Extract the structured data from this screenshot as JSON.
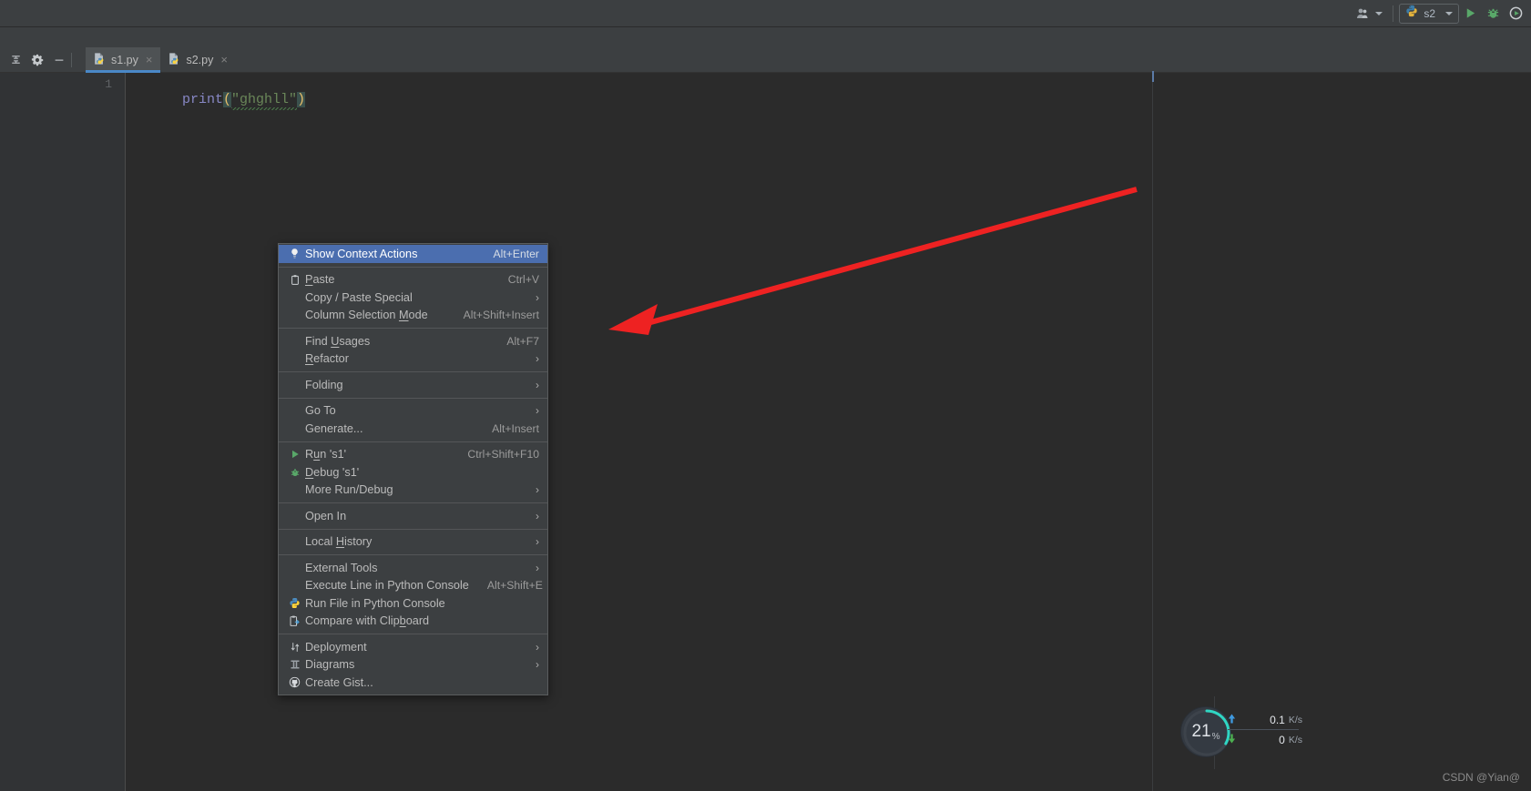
{
  "window": {
    "background": "#3c3f41"
  },
  "toolbar": {
    "user_icon": "people-icon",
    "run_config": {
      "label": "s2",
      "icon": "python-icon"
    },
    "run_button": "run-icon",
    "debug_button": "debug-icon",
    "coverage_button": "run-with-coverage-icon"
  },
  "tab_tools": {
    "collapse_icon": "collapse-all-icon",
    "settings_icon": "gear-icon",
    "hide_icon": "minimize-icon"
  },
  "tabs": [
    {
      "label": "s1.py",
      "icon": "python-file-icon",
      "active": true,
      "close": "×"
    },
    {
      "label": "s2.py",
      "icon": "python-file-icon",
      "active": false,
      "close": "×"
    }
  ],
  "editor": {
    "line_number": "1",
    "code": {
      "func": "print",
      "open_paren": "(",
      "string": "\"ghghll\"",
      "close_paren": ")"
    }
  },
  "context_menu": {
    "items": [
      {
        "label": "Show Context Actions",
        "shortcut": "Alt+Enter",
        "icon": "lightbulb-icon",
        "selected": true,
        "accel": ""
      },
      {
        "type": "separator"
      },
      {
        "label": "Paste",
        "shortcut": "Ctrl+V",
        "icon": "clipboard-icon",
        "accel": "P"
      },
      {
        "label": "Copy / Paste Special",
        "shortcut": "",
        "submenu": true
      },
      {
        "label": "Column Selection Mode",
        "shortcut": "Alt+Shift+Insert",
        "accel": "M"
      },
      {
        "type": "separator"
      },
      {
        "label": "Find Usages",
        "shortcut": "Alt+F7",
        "accel": "U"
      },
      {
        "label": "Refactor",
        "shortcut": "",
        "submenu": true,
        "accel": "R"
      },
      {
        "type": "separator"
      },
      {
        "label": "Folding",
        "shortcut": "",
        "submenu": true
      },
      {
        "type": "separator"
      },
      {
        "label": "Go To",
        "shortcut": "",
        "submenu": true
      },
      {
        "label": "Generate...",
        "shortcut": "Alt+Insert"
      },
      {
        "type": "separator"
      },
      {
        "label": "Run 's1'",
        "shortcut": "Ctrl+Shift+F10",
        "icon": "run-icon",
        "accel": "u"
      },
      {
        "label": "Debug 's1'",
        "shortcut": "",
        "icon": "debug-icon",
        "accel": "D"
      },
      {
        "label": "More Run/Debug",
        "shortcut": "",
        "submenu": true
      },
      {
        "type": "separator"
      },
      {
        "label": "Open In",
        "shortcut": "",
        "submenu": true
      },
      {
        "type": "separator"
      },
      {
        "label": "Local History",
        "shortcut": "",
        "submenu": true,
        "accel": "H"
      },
      {
        "type": "separator"
      },
      {
        "label": "External Tools",
        "shortcut": "",
        "submenu": true
      },
      {
        "label": "Execute Line in Python Console",
        "shortcut": "Alt+Shift+E"
      },
      {
        "label": "Run File in Python Console",
        "shortcut": "",
        "icon": "python-icon"
      },
      {
        "label": "Compare with Clipboard",
        "shortcut": "",
        "icon": "compare-clipboard-icon",
        "accel": "b"
      },
      {
        "type": "separator"
      },
      {
        "label": "Deployment",
        "shortcut": "",
        "submenu": true,
        "icon": "deployment-icon"
      },
      {
        "label": "Diagrams",
        "shortcut": "",
        "submenu": true,
        "icon": "diagrams-icon"
      },
      {
        "label": "Create Gist...",
        "shortcut": "",
        "icon": "github-icon"
      }
    ]
  },
  "net_widget": {
    "cpu_percent": "21",
    "percent_symbol": "%",
    "upload": {
      "value": "0.1",
      "unit": "K/s",
      "arrow": "up-arrow-icon"
    },
    "download": {
      "value": "0",
      "unit": "K/s",
      "arrow": "down-arrow-icon"
    }
  },
  "annotation": {
    "arrow_color": "#ee2222"
  },
  "watermark": "CSDN @Yian@"
}
